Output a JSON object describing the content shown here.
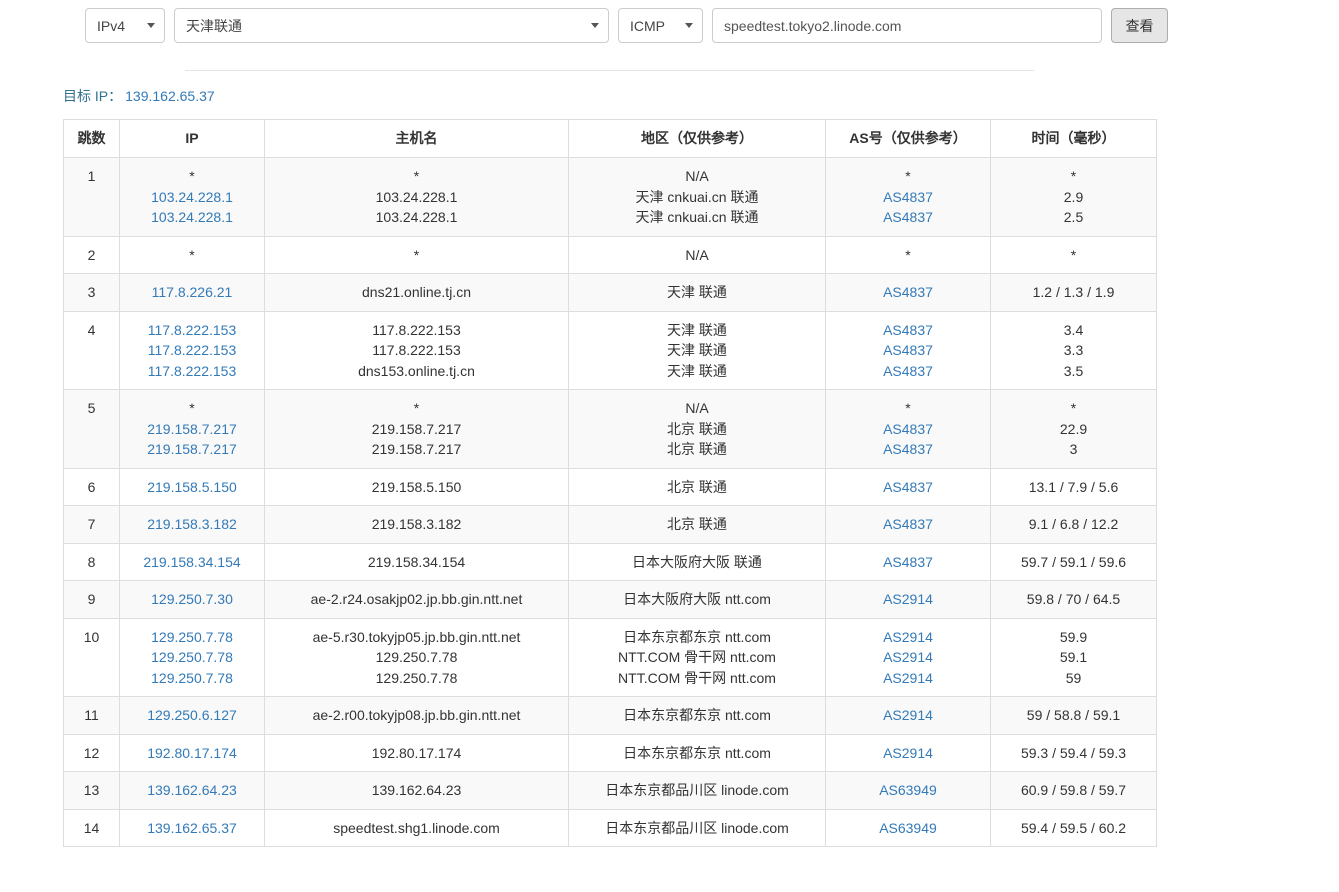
{
  "colors": {
    "link": "#337ab7",
    "target_label": "#31708f",
    "button_bg": "#e6e6e6",
    "row_stripe": "#f9f9f9",
    "table_border": "#dddddd"
  },
  "toolbar": {
    "ip_version": "IPv4",
    "node": "天津联通",
    "protocol": "ICMP",
    "target_value": "speedtest.tokyo2.linode.com",
    "submit_label": "查看"
  },
  "result": {
    "target_label": "目标 IP：",
    "target_ip": "139.162.65.37"
  },
  "table": {
    "headers": [
      "跳数",
      "IP",
      "主机名",
      "地区（仅供参考）",
      "AS号（仅供参考）",
      "时间（毫秒）"
    ],
    "rows": [
      {
        "hop": "1",
        "ip": [
          "*",
          "103.24.228.1",
          "103.24.228.1"
        ],
        "hostname": [
          "*",
          "103.24.228.1",
          "103.24.228.1"
        ],
        "region": [
          "N/A",
          "天津 cnkuai.cn 联通",
          "天津 cnkuai.cn 联通"
        ],
        "asn": [
          "*",
          "AS4837",
          "AS4837"
        ],
        "time": [
          "*",
          "2.9",
          "2.5"
        ]
      },
      {
        "hop": "2",
        "ip": [
          "*"
        ],
        "hostname": [
          "*"
        ],
        "region": [
          "N/A"
        ],
        "asn": [
          "*"
        ],
        "time": [
          "*"
        ]
      },
      {
        "hop": "3",
        "ip": [
          "117.8.226.21"
        ],
        "hostname": [
          "dns21.online.tj.cn"
        ],
        "region": [
          "天津 联通"
        ],
        "asn": [
          "AS4837"
        ],
        "time": [
          "1.2 / 1.3 / 1.9"
        ]
      },
      {
        "hop": "4",
        "ip": [
          "117.8.222.153",
          "117.8.222.153",
          "117.8.222.153"
        ],
        "hostname": [
          "117.8.222.153",
          "117.8.222.153",
          "dns153.online.tj.cn"
        ],
        "region": [
          "天津 联通",
          "天津 联通",
          "天津 联通"
        ],
        "asn": [
          "AS4837",
          "AS4837",
          "AS4837"
        ],
        "time": [
          "3.4",
          "3.3",
          "3.5"
        ]
      },
      {
        "hop": "5",
        "ip": [
          "*",
          "219.158.7.217",
          "219.158.7.217"
        ],
        "hostname": [
          "*",
          "219.158.7.217",
          "219.158.7.217"
        ],
        "region": [
          "N/A",
          "北京 联通",
          "北京 联通"
        ],
        "asn": [
          "*",
          "AS4837",
          "AS4837"
        ],
        "time": [
          "*",
          "22.9",
          "3"
        ]
      },
      {
        "hop": "6",
        "ip": [
          "219.158.5.150"
        ],
        "hostname": [
          "219.158.5.150"
        ],
        "region": [
          "北京 联通"
        ],
        "asn": [
          "AS4837"
        ],
        "time": [
          "13.1 / 7.9 / 5.6"
        ]
      },
      {
        "hop": "7",
        "ip": [
          "219.158.3.182"
        ],
        "hostname": [
          "219.158.3.182"
        ],
        "region": [
          "北京 联通"
        ],
        "asn": [
          "AS4837"
        ],
        "time": [
          "9.1 / 6.8 / 12.2"
        ]
      },
      {
        "hop": "8",
        "ip": [
          "219.158.34.154"
        ],
        "hostname": [
          "219.158.34.154"
        ],
        "region": [
          "日本大阪府大阪 联通"
        ],
        "asn": [
          "AS4837"
        ],
        "time": [
          "59.7 / 59.1 / 59.6"
        ]
      },
      {
        "hop": "9",
        "ip": [
          "129.250.7.30"
        ],
        "hostname": [
          "ae-2.r24.osakjp02.jp.bb.gin.ntt.net"
        ],
        "region": [
          "日本大阪府大阪 ntt.com"
        ],
        "asn": [
          "AS2914"
        ],
        "time": [
          "59.8 / 70 / 64.5"
        ]
      },
      {
        "hop": "10",
        "ip": [
          "129.250.7.78",
          "129.250.7.78",
          "129.250.7.78"
        ],
        "hostname": [
          "ae-5.r30.tokyjp05.jp.bb.gin.ntt.net",
          "129.250.7.78",
          "129.250.7.78"
        ],
        "region": [
          "日本东京都东京 ntt.com",
          "NTT.COM 骨干网 ntt.com",
          "NTT.COM 骨干网 ntt.com"
        ],
        "asn": [
          "AS2914",
          "AS2914",
          "AS2914"
        ],
        "time": [
          "59.9",
          "59.1",
          "59"
        ]
      },
      {
        "hop": "11",
        "ip": [
          "129.250.6.127"
        ],
        "hostname": [
          "ae-2.r00.tokyjp08.jp.bb.gin.ntt.net"
        ],
        "region": [
          "日本东京都东京 ntt.com"
        ],
        "asn": [
          "AS2914"
        ],
        "time": [
          "59 / 58.8 / 59.1"
        ]
      },
      {
        "hop": "12",
        "ip": [
          "192.80.17.174"
        ],
        "hostname": [
          "192.80.17.174"
        ],
        "region": [
          "日本东京都东京 ntt.com"
        ],
        "asn": [
          "AS2914"
        ],
        "time": [
          "59.3 / 59.4 / 59.3"
        ]
      },
      {
        "hop": "13",
        "ip": [
          "139.162.64.23"
        ],
        "hostname": [
          "139.162.64.23"
        ],
        "region": [
          "日本东京都品川区 linode.com"
        ],
        "asn": [
          "AS63949"
        ],
        "time": [
          "60.9 / 59.8 / 59.7"
        ]
      },
      {
        "hop": "14",
        "ip": [
          "139.162.65.37"
        ],
        "hostname": [
          "speedtest.shg1.linode.com"
        ],
        "region": [
          "日本东京都品川区 linode.com"
        ],
        "asn": [
          "AS63949"
        ],
        "time": [
          "59.4 / 59.5 / 60.2"
        ]
      }
    ]
  }
}
